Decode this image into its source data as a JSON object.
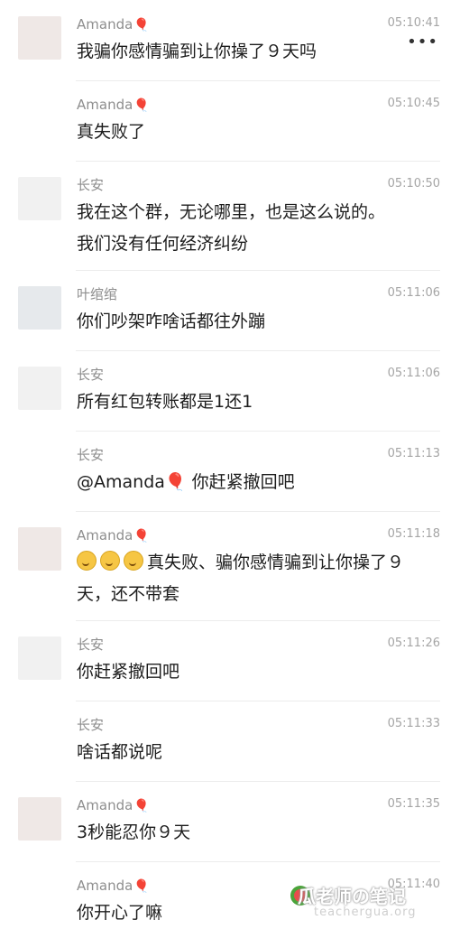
{
  "more_label": "•••",
  "messages": [
    {
      "name": "Amanda",
      "balloon": true,
      "time": "05:10:41",
      "avatar": "amanda",
      "lines": [
        "我骗你感情骗到让你操了９天吗"
      ]
    },
    {
      "name": "Amanda",
      "balloon": true,
      "time": "05:10:45",
      "avatar": "",
      "lines": [
        "真失败了"
      ]
    },
    {
      "name": "长安",
      "balloon": false,
      "time": "05:10:50",
      "avatar": "changan",
      "lines": [
        "我在这个群，无论哪里，也是这么说的。",
        "我们没有任何经济纠纷"
      ]
    },
    {
      "name": "叶绾绾",
      "balloon": false,
      "time": "05:11:06",
      "avatar": "ye",
      "lines": [
        "你们吵架咋啥话都往外蹦"
      ]
    },
    {
      "name": "长安",
      "balloon": false,
      "time": "05:11:06",
      "avatar": "changan",
      "lines": [
        "所有红包转账都是1还1"
      ]
    },
    {
      "name": "长安",
      "balloon": false,
      "time": "05:11:13",
      "avatar": "",
      "lines": [
        "@Amanda🎈 你赶紧撤回吧"
      ]
    },
    {
      "name": "Amanda",
      "balloon": true,
      "time": "05:11:18",
      "avatar": "amanda",
      "emoji": 3,
      "lines": [
        "真失败、骗你感情骗到让你操了９",
        "天，还不带套"
      ]
    },
    {
      "name": "长安",
      "balloon": false,
      "time": "05:11:26",
      "avatar": "changan",
      "lines": [
        "你赶紧撤回吧"
      ]
    },
    {
      "name": "长安",
      "balloon": false,
      "time": "05:11:33",
      "avatar": "",
      "lines": [
        "啥话都说呢"
      ]
    },
    {
      "name": "Amanda",
      "balloon": true,
      "time": "05:11:35",
      "avatar": "amanda",
      "lines": [
        "3秒能忍你９天"
      ]
    },
    {
      "name": "Amanda",
      "balloon": true,
      "time": "05:11:40",
      "avatar": "",
      "lines": [
        "你开心了嘛"
      ]
    }
  ],
  "balloon_glyph": "🎈",
  "watermark": {
    "main": "瓜老师の笔记",
    "sub": "teachergua.org"
  }
}
